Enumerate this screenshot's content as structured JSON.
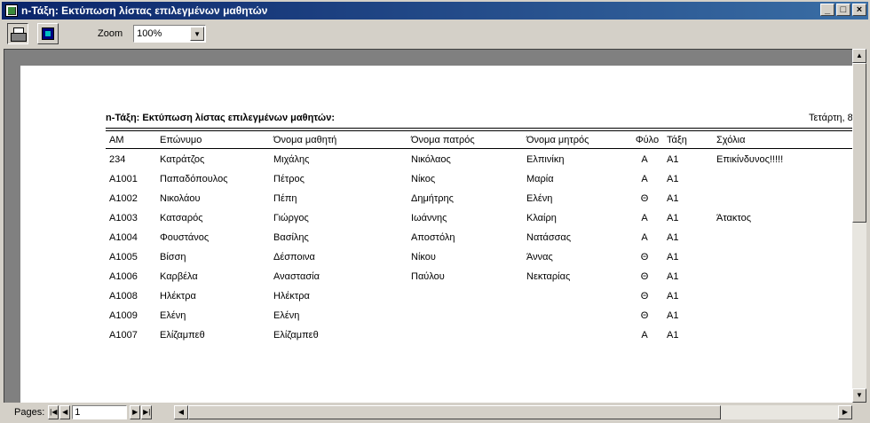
{
  "window": {
    "title": "n-Τάξη: Εκτύπωση λίστας επιλεγμένων μαθητών",
    "min_glyph": "_",
    "max_glyph": "□",
    "close_glyph": "×"
  },
  "toolbar": {
    "zoom_label": "Zoom",
    "zoom_value": "100%",
    "print_icon": "printer-icon",
    "setup_icon": "page-setup-icon"
  },
  "report": {
    "title": "n-Τάξη: Εκτύπωση λίστας επιλεγμένων μαθητών:",
    "date": "Τετάρτη, 8",
    "columns": [
      "ΑΜ",
      "Επώνυμο",
      "Όνομα μαθητή",
      "Όνομα πατρός",
      "Όνομα μητρός",
      "Φύλο",
      "Τάξη",
      "Σχόλια"
    ],
    "rows": [
      [
        "234",
        "Κατράτζος",
        "Μιχάλης",
        "Νικόλαος",
        "Ελπινίκη",
        "Α",
        "Α1",
        "Επικίνδυνος!!!!!"
      ],
      [
        "Α1001",
        "Παπαδόπουλος",
        "Πέτρος",
        "Νίκος",
        "Μαρία",
        "Α",
        "Α1",
        ""
      ],
      [
        "Α1002",
        "Νικολάου",
        "Πέπη",
        "Δημήτρης",
        "Ελένη",
        "Θ",
        "Α1",
        ""
      ],
      [
        "Α1003",
        "Κατσαρός",
        "Γιώργος",
        "Ιωάννης",
        "Κλαίρη",
        "Α",
        "Α1",
        "Άτακτος"
      ],
      [
        "Α1004",
        "Φουστάνος",
        "Βασίλης",
        "Αποστόλη",
        "Νατάσσας",
        "Α",
        "Α1",
        ""
      ],
      [
        "Α1005",
        "Βίσση",
        "Δέσποινα",
        "Νίκου",
        "Άννας",
        "Θ",
        "Α1",
        ""
      ],
      [
        "Α1006",
        "Καρβέλα",
        "Αναστασία",
        "Παύλου",
        "Νεκταρίας",
        "Θ",
        "Α1",
        ""
      ],
      [
        "Α1008",
        "Ηλέκτρα",
        "Ηλέκτρα",
        "",
        "",
        "Θ",
        "Α1",
        ""
      ],
      [
        "Α1009",
        "Ελένη",
        "Ελένη",
        "",
        "",
        "Θ",
        "Α1",
        ""
      ],
      [
        "Α1007",
        "Ελίζαμπεθ",
        "Ελίζαμπεθ",
        "",
        "",
        "Α",
        "Α1",
        ""
      ]
    ]
  },
  "bottombar": {
    "pages_label": "Pages:",
    "page_value": "1"
  },
  "glyphs": {
    "first": "|◀",
    "prev": "◀",
    "next": "▶",
    "last": "▶|",
    "up": "▲",
    "down": "▼",
    "left": "◀",
    "right": "▶",
    "dropdown": "▼"
  }
}
